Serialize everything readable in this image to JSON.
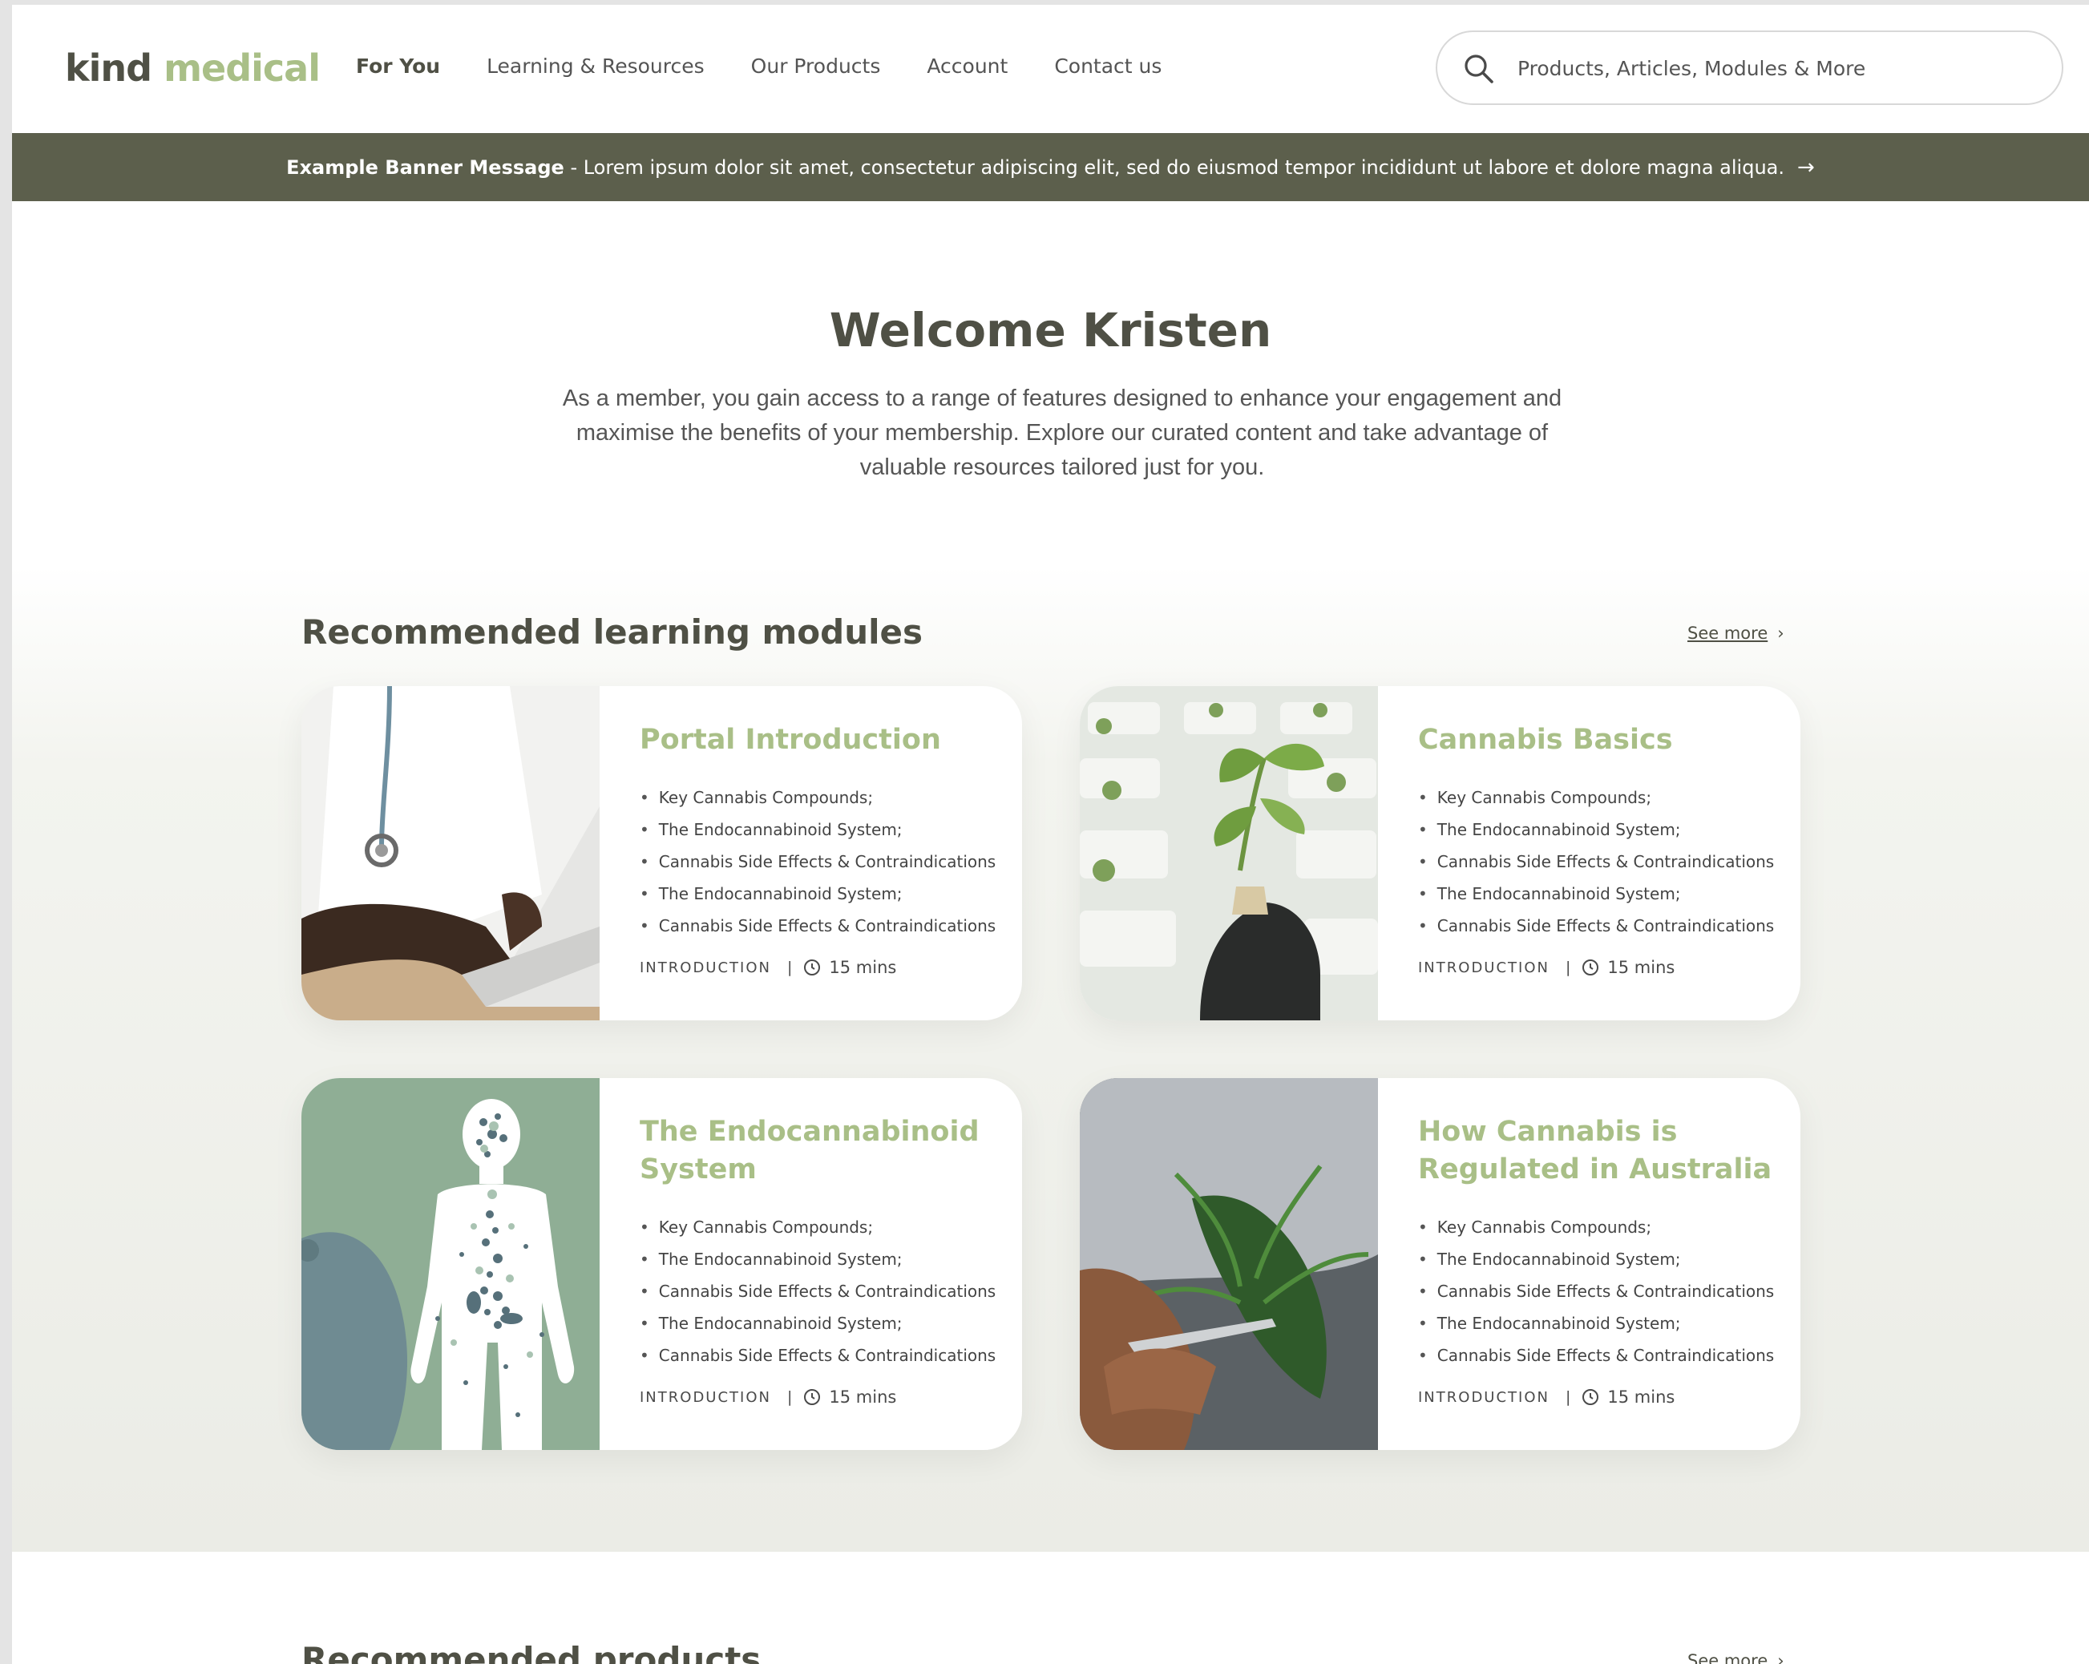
{
  "header": {
    "logo": {
      "part1": "kind",
      "part2": "medical"
    },
    "nav": [
      "For You",
      "Learning & Resources",
      "Our Products",
      "Account",
      "Contact us"
    ],
    "search": {
      "placeholder": "Products, Articles, Modules & More"
    }
  },
  "banner": {
    "title": "Example Banner Message",
    "text": " - Lorem ipsum dolor sit amet, consectetur adipiscing elit, sed do eiusmod tempor incididunt ut labore et dolore magna aliqua.",
    "arrow": "→"
  },
  "welcome": {
    "title": "Welcome Kristen",
    "text": "As a member, you gain access to a range of features designed to enhance your engagement and maximise the benefits of your membership. Explore our curated content and take advantage of valuable resources tailored just for you."
  },
  "modules": {
    "title": "Recommended learning modules",
    "see_more": "See more",
    "cards": [
      {
        "title": "Portal Introduction",
        "items": [
          "Key Cannabis Compounds;",
          "The Endocannabinoid System;",
          "Cannabis Side Effects & Contraindications",
          "The Endocannabinoid System;",
          "Cannabis Side Effects & Contraindications"
        ],
        "category": "INTRODUCTION",
        "separator": "|",
        "duration": "15 mins"
      },
      {
        "title": "Cannabis Basics",
        "items": [
          "Key Cannabis Compounds;",
          "The Endocannabinoid System;",
          "Cannabis Side Effects & Contraindications",
          "The Endocannabinoid System;",
          "Cannabis Side Effects & Contraindications"
        ],
        "category": "INTRODUCTION",
        "separator": "|",
        "duration": "15 mins"
      },
      {
        "title": "The Endocannabinoid System",
        "items": [
          "Key Cannabis Compounds;",
          "The Endocannabinoid System;",
          "Cannabis Side Effects & Contraindications",
          "The Endocannabinoid System;",
          "Cannabis Side Effects & Contraindications"
        ],
        "category": "INTRODUCTION",
        "separator": "|",
        "duration": "15 mins"
      },
      {
        "title": "How Cannabis is Regulated in Australia",
        "items": [
          "Key Cannabis Compounds;",
          "The Endocannabinoid System;",
          "Cannabis Side Effects & Contraindications",
          "The Endocannabinoid System;",
          "Cannabis Side Effects & Contraindications"
        ],
        "category": "INTRODUCTION",
        "separator": "|",
        "duration": "15 mins"
      }
    ]
  },
  "products": {
    "title": "Recommended products",
    "see_more": "See more"
  },
  "icons": [
    "search-icon",
    "arrow-right-icon",
    "chevron-right-icon",
    "clock-icon"
  ],
  "colors": {
    "brand_dark": "#4f5045",
    "brand_green": "#a9bf87",
    "banner_bg": "#5c5f4c"
  }
}
